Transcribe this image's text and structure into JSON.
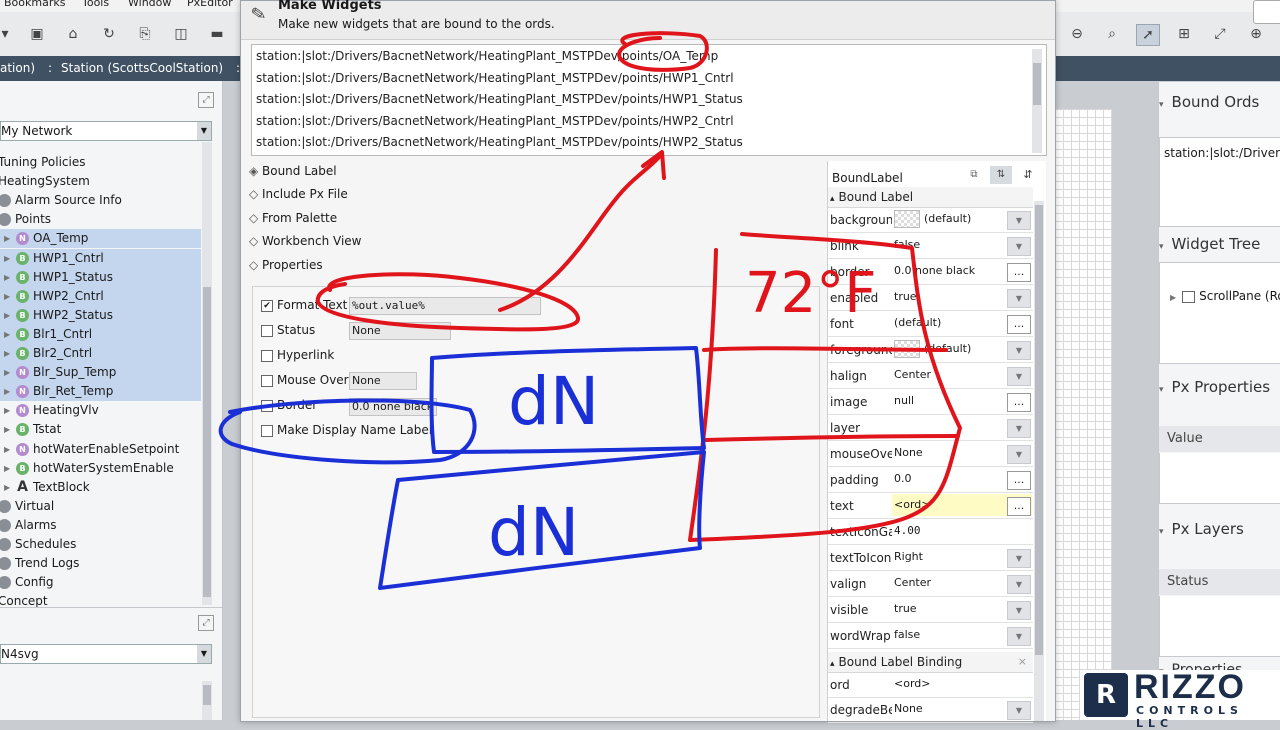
{
  "menubar": {
    "items": [
      "Bookmarks",
      "Tools",
      "Window",
      "PxEditor"
    ]
  },
  "pathbar": {
    "crumb_left": "ation)",
    "crumb_station": "Station (ScottsCoolStation)"
  },
  "nav": {
    "network_select": "My Network",
    "tree": [
      {
        "label": "Tuning Policies",
        "icon": "",
        "indent": 0,
        "hl": false
      },
      {
        "label": "HeatingSystem",
        "icon": "",
        "indent": 0,
        "hl": false
      },
      {
        "label": "Alarm Source Info",
        "icon": "g",
        "indent": 0,
        "hl": false
      },
      {
        "label": "Points",
        "icon": "g",
        "indent": 0,
        "hl": false
      },
      {
        "label": "OA_Temp",
        "icon": "N",
        "indent": 1,
        "hl": true
      },
      {
        "label": "HWP1_Cntrl",
        "icon": "B",
        "indent": 1,
        "hl": true
      },
      {
        "label": "HWP1_Status",
        "icon": "B",
        "indent": 1,
        "hl": true
      },
      {
        "label": "HWP2_Cntrl",
        "icon": "B",
        "indent": 1,
        "hl": true
      },
      {
        "label": "HWP2_Status",
        "icon": "B",
        "indent": 1,
        "hl": true
      },
      {
        "label": "Blr1_Cntrl",
        "icon": "B",
        "indent": 1,
        "hl": true
      },
      {
        "label": "Blr2_Cntrl",
        "icon": "B",
        "indent": 1,
        "hl": true
      },
      {
        "label": "Blr_Sup_Temp",
        "icon": "N",
        "indent": 1,
        "hl": true
      },
      {
        "label": "Blr_Ret_Temp",
        "icon": "N",
        "indent": 1,
        "hl": true
      },
      {
        "label": "HeatingVlv",
        "icon": "N",
        "indent": 1,
        "hl": false
      },
      {
        "label": "Tstat",
        "icon": "B",
        "indent": 1,
        "hl": false
      },
      {
        "label": "hotWaterEnableSetpoint",
        "icon": "N",
        "indent": 1,
        "hl": false
      },
      {
        "label": "hotWaterSystemEnable",
        "icon": "B",
        "indent": 1,
        "hl": false
      },
      {
        "label": "TextBlock",
        "icon": "A",
        "indent": 1,
        "hl": false
      },
      {
        "label": "Virtual",
        "icon": "g",
        "indent": 0,
        "hl": false
      },
      {
        "label": "Alarms",
        "icon": "g",
        "indent": 0,
        "hl": false
      },
      {
        "label": "Schedules",
        "icon": "g",
        "indent": 0,
        "hl": false
      },
      {
        "label": "Trend Logs",
        "icon": "g",
        "indent": 0,
        "hl": false
      },
      {
        "label": "Config",
        "icon": "g",
        "indent": 0,
        "hl": false
      },
      {
        "label": "Concept",
        "icon": "",
        "indent": 0,
        "hl": false
      }
    ],
    "palette_select": "N4svg"
  },
  "dialog": {
    "title": "Make Widgets",
    "subtitle": "Make new widgets that are bound to the ords.",
    "ords": [
      "station:|slot:/Drivers/BacnetNetwork/HeatingPlant_MSTPDev/points/OA_Temp",
      "station:|slot:/Drivers/BacnetNetwork/HeatingPlant_MSTPDev/points/HWP1_Cntrl",
      "station:|slot:/Drivers/BacnetNetwork/HeatingPlant_MSTPDev/points/HWP1_Status",
      "station:|slot:/Drivers/BacnetNetwork/HeatingPlant_MSTPDev/points/HWP2_Cntrl",
      "station:|slot:/Drivers/BacnetNetwork/HeatingPlant_MSTPDev/points/HWP2_Status"
    ],
    "widget_types": [
      {
        "label": "Bound Label",
        "selected": true
      },
      {
        "label": "Include Px File",
        "selected": false
      },
      {
        "label": "From Palette",
        "selected": false
      },
      {
        "label": "Workbench View",
        "selected": false
      },
      {
        "label": "Properties",
        "selected": false
      }
    ],
    "options": {
      "format_text": {
        "label": "Format Text",
        "checked": true,
        "value": "%out.value%"
      },
      "status": {
        "label": "Status",
        "checked": false,
        "value": "None"
      },
      "hyperlink": {
        "label": "Hyperlink",
        "checked": false
      },
      "mouse_over": {
        "label": "Mouse Over",
        "checked": false,
        "value": "None"
      },
      "border": {
        "label": "Border",
        "checked": false,
        "value": "0.0 none black"
      },
      "display_name": {
        "label": "Make Display Name Label",
        "checked": false
      }
    }
  },
  "propsheet": {
    "header": "BoundLabel",
    "section1": "Bound Label",
    "rows": [
      {
        "name": "background",
        "value": "(default)",
        "btn": "dd",
        "swatch": true,
        "yellow": false
      },
      {
        "name": "blink",
        "value": "false",
        "btn": "dd",
        "swatch": false,
        "yellow": false
      },
      {
        "name": "border",
        "value": "0.0 none black",
        "btn": "dots",
        "swatch": false,
        "yellow": false
      },
      {
        "name": "enabled",
        "value": "true",
        "btn": "dd",
        "swatch": false,
        "yellow": false
      },
      {
        "name": "font",
        "value": "(default)",
        "btn": "dots",
        "swatch": false,
        "yellow": false
      },
      {
        "name": "foreground",
        "value": "(default)",
        "btn": "dd",
        "swatch": true,
        "yellow": false
      },
      {
        "name": "halign",
        "value": "Center",
        "btn": "dd",
        "swatch": false,
        "yellow": false
      },
      {
        "name": "image",
        "value": "null",
        "btn": "dots",
        "swatch": false,
        "yellow": false
      },
      {
        "name": "layer",
        "value": "",
        "btn": "dd",
        "swatch": false,
        "yellow": false
      },
      {
        "name": "mouseOver",
        "value": "None",
        "btn": "dd",
        "swatch": false,
        "yellow": false
      },
      {
        "name": "padding",
        "value": "0.0",
        "btn": "dots",
        "swatch": false,
        "yellow": false
      },
      {
        "name": "text",
        "value": "<ord>",
        "btn": "dots",
        "swatch": false,
        "yellow": true
      },
      {
        "name": "textIconGap",
        "value": "4.00",
        "btn": "",
        "swatch": false,
        "yellow": false
      },
      {
        "name": "textToIcon",
        "value": "Right",
        "btn": "dd",
        "swatch": false,
        "yellow": false
      },
      {
        "name": "valign",
        "value": "Center",
        "btn": "dd",
        "swatch": false,
        "yellow": false
      },
      {
        "name": "visible",
        "value": "true",
        "btn": "dd",
        "swatch": false,
        "yellow": false
      },
      {
        "name": "wordWrap",
        "value": "false",
        "btn": "dd",
        "swatch": false,
        "yellow": false
      }
    ],
    "section2": "Bound Label Binding",
    "binding_rows": [
      {
        "name": "ord",
        "value": "<ord>"
      },
      {
        "name": "degradeBehavior",
        "value": "None"
      }
    ]
  },
  "rightpanel": {
    "bound_ords_title": "Bound Ords",
    "bound_ords_value": "station:|slot:/Drivers/",
    "widget_tree_title": "Widget Tree",
    "widget_tree_item": "ScrollPane (Ro",
    "px_properties_title": "Px Properties",
    "px_properties_col": "Value",
    "px_layers_title": "Px Layers",
    "px_layers_col": "Status",
    "properties_title": "Properties"
  },
  "logo": {
    "mark": "R",
    "word": "RIZZO",
    "sub": "CONTROLS LLC"
  },
  "annotations": {
    "red_text": "72°F",
    "blue_text_1": "dN",
    "blue_text_2": "dN"
  },
  "colors": {
    "pathbar": "#3f5163",
    "highlight": "#c4d5ee",
    "red_ink": "#e0141b",
    "blue_ink": "#1a2fd6",
    "logo": "#1c2e4a"
  }
}
